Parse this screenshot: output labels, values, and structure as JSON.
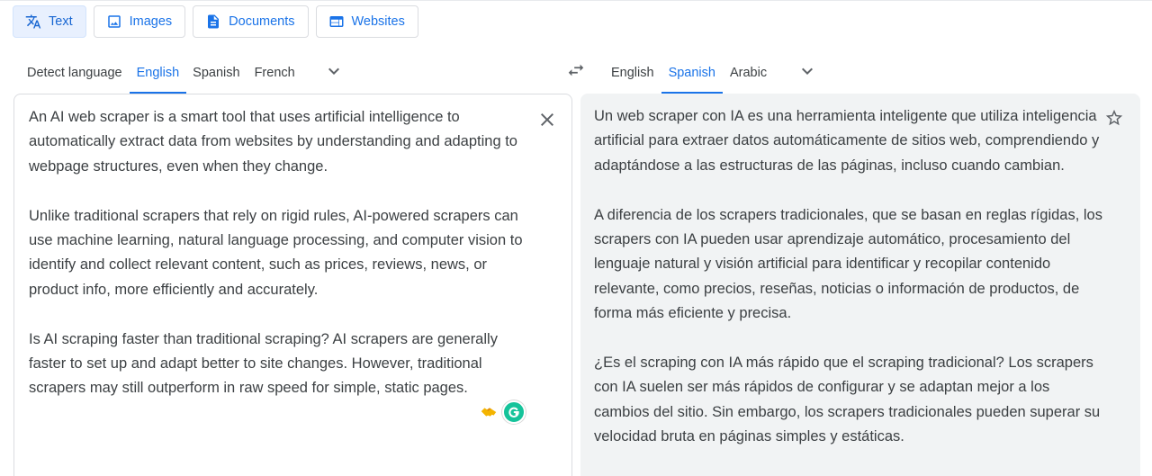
{
  "modes": [
    {
      "label": "Text",
      "icon": "translate-icon",
      "active": true
    },
    {
      "label": "Images",
      "icon": "image-icon",
      "active": false
    },
    {
      "label": "Documents",
      "icon": "document-icon",
      "active": false
    },
    {
      "label": "Websites",
      "icon": "website-icon",
      "active": false
    }
  ],
  "source_languages": {
    "detect": "Detect language",
    "tabs": [
      "English",
      "Spanish",
      "French"
    ],
    "active": "English"
  },
  "target_languages": {
    "tabs": [
      "English",
      "Spanish",
      "Arabic"
    ],
    "active": "Spanish"
  },
  "source_text": [
    "An AI web scraper is a smart tool that uses artificial intelligence to automatically extract data from websites by understanding and adapting to webpage structures, even when they change.",
    "Unlike traditional scrapers that rely on rigid rules, AI-powered scrapers can use machine learning, natural language processing, and computer vision to identify and collect relevant content, such as prices, reviews, news, or product info, more efficiently and accurately.",
    "Is AI scraping faster than traditional scraping? AI scrapers are generally faster to set up and adapt better to site changes. However, traditional scrapers may still outperform in raw speed for simple, static pages."
  ],
  "translated_text": [
    "Un web scraper con IA es una herramienta inteligente que utiliza inteligencia artificial para extraer datos automáticamente de sitios web, comprendiendo y adaptándose a las estructuras de las páginas, incluso cuando cambian.",
    "A diferencia de los scrapers tradicionales, que se basan en reglas rígidas, los scrapers con IA pueden usar aprendizaje automático, procesamiento del lenguaje natural y visión artificial para identificar y recopilar contenido relevante, como precios, reseñas, noticias o información de productos, de forma más eficiente y precisa.",
    "¿Es el scraping con IA más rápido que el scraping tradicional? Los scrapers con IA suelen ser más rápidos de configurar y se adaptan mejor a los cambios del sitio. Sin embargo, los scrapers tradicionales pueden superar su velocidad bruta en páginas simples y estáticas."
  ],
  "icons": {
    "swap": "swap-languages-icon",
    "clear": "close-icon",
    "save": "star-icon",
    "extension_hand": "handshake-icon",
    "extension_grammarly": "grammarly-icon"
  },
  "colors": {
    "accent": "#1a73e8",
    "active_mode_bg": "#e8f0fe",
    "target_panel_bg": "#f1f3f4",
    "grammarly": "#15c39a"
  }
}
